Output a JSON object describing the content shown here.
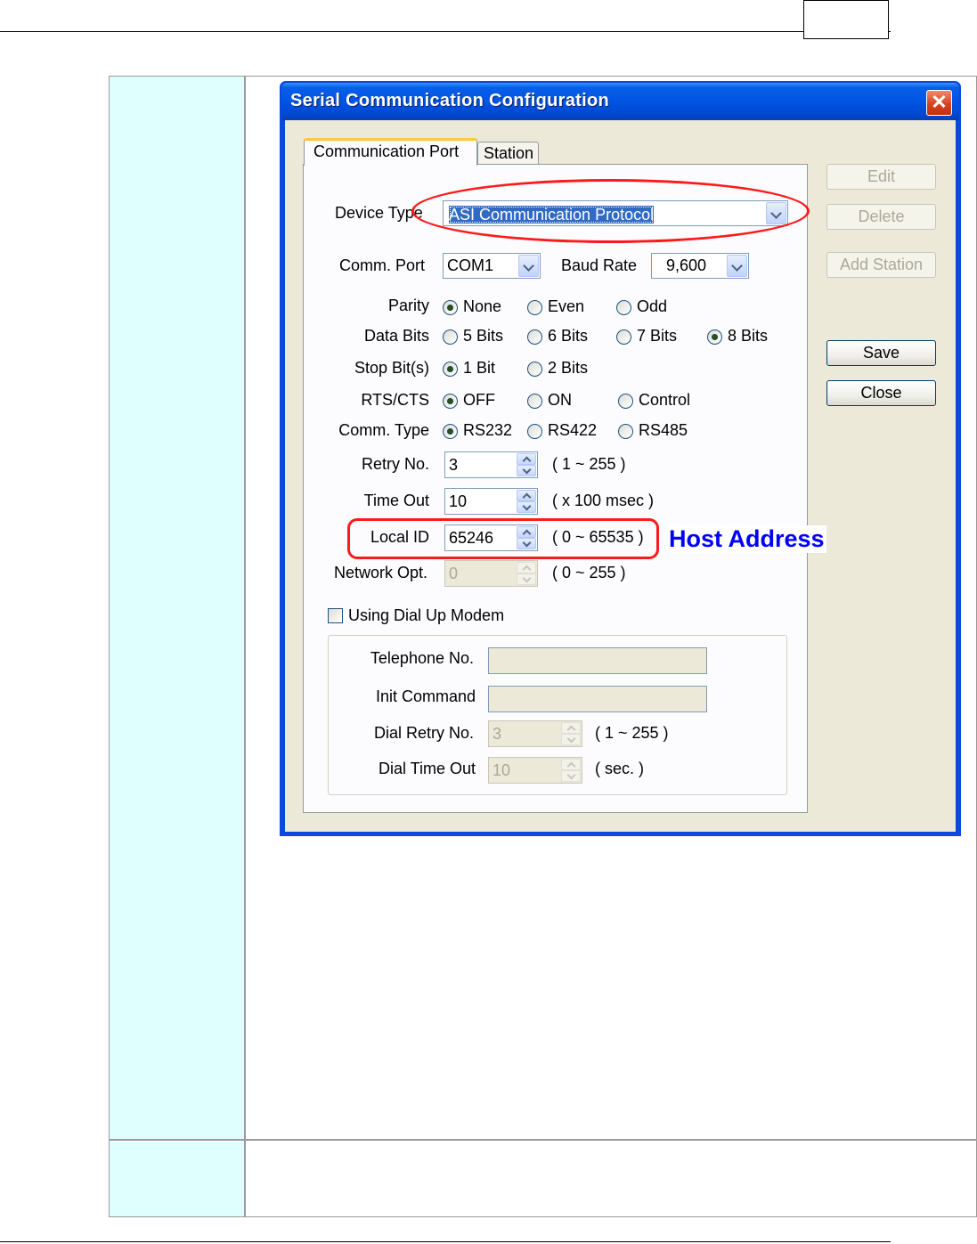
{
  "dialog": {
    "title": "Serial Communication Configuration",
    "close_glyph": "✕",
    "tabs": [
      {
        "label": "Communication Port",
        "active": true
      },
      {
        "label": "Station",
        "active": false
      }
    ],
    "device_type": {
      "label": "Device Type",
      "value": "ASI Communication Protocol"
    },
    "comm_port": {
      "label": "Comm. Port",
      "value": "COM1"
    },
    "baud_rate": {
      "label": "Baud Rate",
      "value": "9,600"
    },
    "parity": {
      "label": "Parity",
      "options": [
        "None",
        "Even",
        "Odd"
      ],
      "selected": "None"
    },
    "data_bits": {
      "label": "Data Bits",
      "options": [
        "5 Bits",
        "6 Bits",
        "7 Bits",
        "8 Bits"
      ],
      "selected": "8 Bits"
    },
    "stop_bits": {
      "label": "Stop Bit(s)",
      "options": [
        "1 Bit",
        "2 Bits"
      ],
      "selected": "1 Bit"
    },
    "rts_cts": {
      "label": "RTS/CTS",
      "options": [
        "OFF",
        "ON",
        "Control"
      ],
      "selected": "OFF"
    },
    "comm_type": {
      "label": "Comm. Type",
      "options": [
        "RS232",
        "RS422",
        "RS485"
      ],
      "selected": "RS232"
    },
    "retry_no": {
      "label": "Retry No.",
      "value": "3",
      "range": "( 1 ~ 255 )"
    },
    "time_out": {
      "label": "Time Out",
      "value": "10",
      "range": "( x 100 msec )"
    },
    "local_id": {
      "label": "Local ID",
      "value": "65246",
      "range": "( 0 ~ 65535 )"
    },
    "network_opt": {
      "label": "Network Opt.",
      "value": "0",
      "range": "( 0 ~ 255 )"
    },
    "dial_up": {
      "checkbox_label": "Using Dial Up Modem",
      "checked": false,
      "telephone_label": "Telephone No.",
      "telephone_value": "",
      "init_label": "Init Command",
      "init_value": "",
      "dial_retry_label": "Dial Retry No.",
      "dial_retry_value": "3",
      "dial_retry_range": "( 1 ~ 255 )",
      "dial_timeout_label": "Dial Time Out",
      "dial_timeout_value": "10",
      "dial_timeout_range": "( sec. )"
    },
    "buttons": {
      "edit": "Edit",
      "delete": "Delete",
      "add_station": "Add Station",
      "save": "Save",
      "close": "Close"
    }
  },
  "annotation": {
    "host_address": "Host Address",
    "color": "#0000ff",
    "highlight_color": "#ff1a1a"
  },
  "colors": {
    "left_cell": "#dfffff",
    "titlebar": "#0054e3",
    "dialog_bg": "#ece9d8"
  }
}
